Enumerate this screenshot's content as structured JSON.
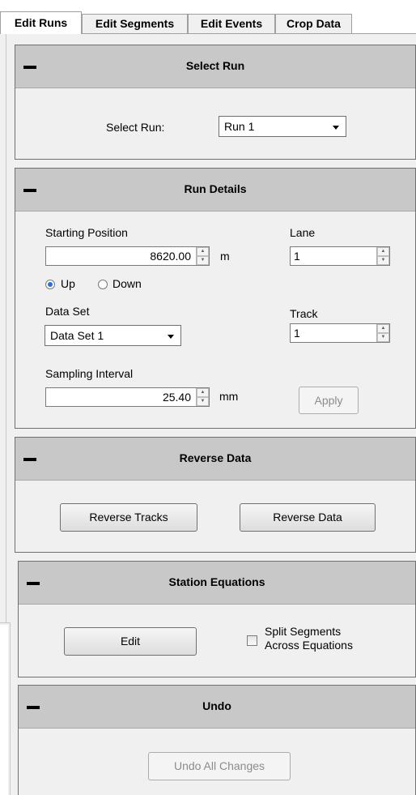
{
  "tabs": [
    {
      "label": "Edit Runs",
      "active": true
    },
    {
      "label": "Edit Segments",
      "active": false
    },
    {
      "label": "Edit Events",
      "active": false
    },
    {
      "label": "Crop Data",
      "active": false
    }
  ],
  "select_run": {
    "title": "Select Run",
    "label": "Select Run:",
    "value": "Run 1"
  },
  "run_details": {
    "title": "Run Details",
    "starting_position_label": "Starting Position",
    "starting_position_value": "8620.00",
    "starting_position_unit": "m",
    "direction_up": "Up",
    "direction_down": "Down",
    "direction_selected": "Up",
    "lane_label": "Lane",
    "lane_value": "1",
    "data_set_label": "Data Set",
    "data_set_value": "Data Set 1",
    "track_label": "Track",
    "track_value": "1",
    "sampling_interval_label": "Sampling Interval",
    "sampling_interval_value": "25.40",
    "sampling_interval_unit": "mm",
    "apply_label": "Apply"
  },
  "reverse_data": {
    "title": "Reverse Data",
    "reverse_tracks_label": "Reverse Tracks",
    "reverse_data_label": "Reverse Data"
  },
  "station_equations": {
    "title": "Station Equations",
    "edit_label": "Edit",
    "split_label_line1": "Split Segments",
    "split_label_line2": "Across Equations",
    "split_checked": false
  },
  "undo": {
    "title": "Undo",
    "undo_all_label": "Undo All Changes"
  },
  "colors": {
    "panel_header": "#c8c8c8",
    "panel_body": "#f0f0f0",
    "radio_selected": "#2b6fd6"
  }
}
